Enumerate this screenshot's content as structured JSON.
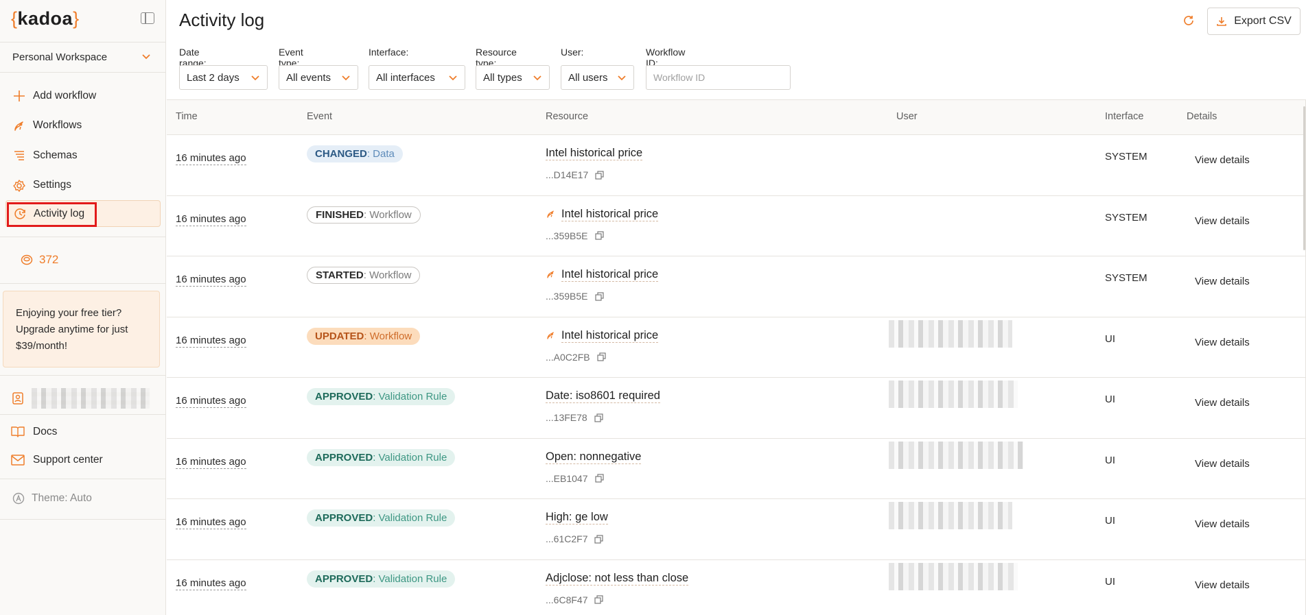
{
  "app": {
    "logo": "kadoa",
    "page_title": "Activity log"
  },
  "sidebar": {
    "workspace": "Personal Workspace",
    "items": [
      {
        "label": "Add workflow",
        "icon": "plus-icon",
        "active": false
      },
      {
        "label": "Workflows",
        "icon": "rocket-icon",
        "active": false
      },
      {
        "label": "Schemas",
        "icon": "schema-icon",
        "active": false
      },
      {
        "label": "Settings",
        "icon": "gear-icon",
        "active": false
      },
      {
        "label": "Activity log",
        "icon": "activity-icon",
        "active": true
      }
    ],
    "credits": "372",
    "promo": "Enjoying your free tier? Upgrade anytime for just $39/month!",
    "links": [
      {
        "label": "Docs",
        "icon": "book-icon"
      },
      {
        "label": "Support center",
        "icon": "mail-icon"
      }
    ],
    "theme": "Theme: Auto"
  },
  "toolbar": {
    "export_label": "Export CSV"
  },
  "filters": {
    "date_range": {
      "label": "Date range:",
      "value": "Last 2 days"
    },
    "event_type": {
      "label": "Event type:",
      "value": "All events"
    },
    "interface": {
      "label": "Interface:",
      "value": "All interfaces"
    },
    "resource_type": {
      "label": "Resource type:",
      "value": "All types"
    },
    "user": {
      "label": "User:",
      "value": "All users"
    },
    "workflow_id": {
      "label": "Workflow ID:",
      "placeholder": "Workflow ID"
    }
  },
  "table": {
    "headers": {
      "time": "Time",
      "event": "Event",
      "resource": "Resource",
      "user": "User",
      "interface": "Interface",
      "details": "Details"
    },
    "rows": [
      {
        "time": "16 minutes ago",
        "status": "CHANGED",
        "rest": " : Data",
        "kind": "changed",
        "resource": "Intel historical price",
        "rocket": false,
        "id": "...D14E17",
        "user_redacted": false,
        "interface": "SYSTEM",
        "details": "View details"
      },
      {
        "time": "16 minutes ago",
        "status": "FINISHED",
        "rest": " : Workflow",
        "kind": "finished",
        "resource": "Intel historical price",
        "rocket": true,
        "id": "...359B5E",
        "user_redacted": false,
        "interface": "SYSTEM",
        "details": "View details"
      },
      {
        "time": "16 minutes ago",
        "status": "STARTED",
        "rest": " : Workflow",
        "kind": "started",
        "resource": "Intel historical price",
        "rocket": true,
        "id": "...359B5E",
        "user_redacted": false,
        "interface": "SYSTEM",
        "details": "View details"
      },
      {
        "time": "16 minutes ago",
        "status": "UPDATED",
        "rest": " : Workflow",
        "kind": "updated",
        "resource": "Intel historical price",
        "rocket": true,
        "id": "...A0C2FB",
        "user_redacted": true,
        "interface": "UI",
        "details": "View details"
      },
      {
        "time": "16 minutes ago",
        "status": "APPROVED",
        "rest": " : Validation Rule",
        "kind": "approved",
        "resource": "Date: iso8601 required",
        "rocket": false,
        "id": "...13FE78",
        "user_redacted": true,
        "interface": "UI",
        "details": "View details"
      },
      {
        "time": "16 minutes ago",
        "status": "APPROVED",
        "rest": " : Validation Rule",
        "kind": "approved",
        "resource": "Open: nonnegative",
        "rocket": false,
        "id": "...EB1047",
        "user_redacted": true,
        "interface": "UI",
        "details": "View details"
      },
      {
        "time": "16 minutes ago",
        "status": "APPROVED",
        "rest": " : Validation Rule",
        "kind": "approved",
        "resource": "High: ge low",
        "rocket": false,
        "id": "...61C2F7",
        "user_redacted": true,
        "interface": "UI",
        "details": "View details"
      },
      {
        "time": "16 minutes ago",
        "status": "APPROVED",
        "rest": " : Validation Rule",
        "kind": "approved",
        "resource": "Adjclose: not less than close",
        "rocket": false,
        "id": "...6C8F47",
        "user_redacted": true,
        "interface": "UI",
        "details": "View details"
      }
    ]
  },
  "colors": {
    "accent": "#ef7d2a",
    "highlight": "#e21a1a"
  }
}
